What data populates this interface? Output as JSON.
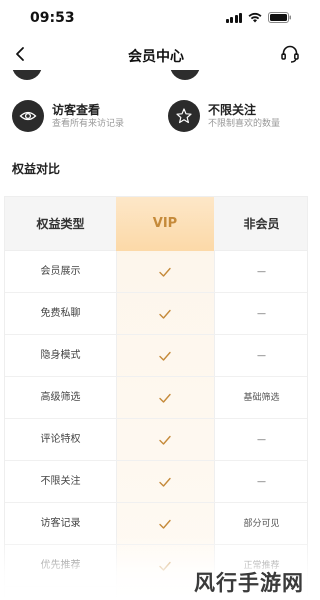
{
  "status_bar": {
    "time": "09:53"
  },
  "nav": {
    "title": "会员中心"
  },
  "features": [
    {
      "title": "访客查看",
      "desc": "查看所有来访记录",
      "icon": "eye-icon"
    },
    {
      "title": "不限关注",
      "desc": "不限制喜欢的数量",
      "icon": "star-icon"
    }
  ],
  "section": {
    "title": "权益对比"
  },
  "table": {
    "headers": [
      "权益类型",
      "VIP",
      "非会员"
    ],
    "rows": [
      {
        "name": "会员展示",
        "vip": "check",
        "normal": "—"
      },
      {
        "name": "免费私聊",
        "vip": "check",
        "normal": "—"
      },
      {
        "name": "隐身模式",
        "vip": "check",
        "normal": "—"
      },
      {
        "name": "高级筛选",
        "vip": "check",
        "normal": "基础筛选"
      },
      {
        "name": "评论特权",
        "vip": "check",
        "normal": "—"
      },
      {
        "name": "不限关注",
        "vip": "check",
        "normal": "—"
      },
      {
        "name": "访客记录",
        "vip": "check",
        "normal": "部分可见"
      },
      {
        "name": "优先推荐",
        "vip": "check",
        "normal": "正常推荐"
      }
    ]
  },
  "watermark": "风行手游网",
  "colors": {
    "vip_gold": "#c58a3a",
    "vip_bg": "#fde7c8",
    "icon_dark": "#2b2b2b"
  }
}
